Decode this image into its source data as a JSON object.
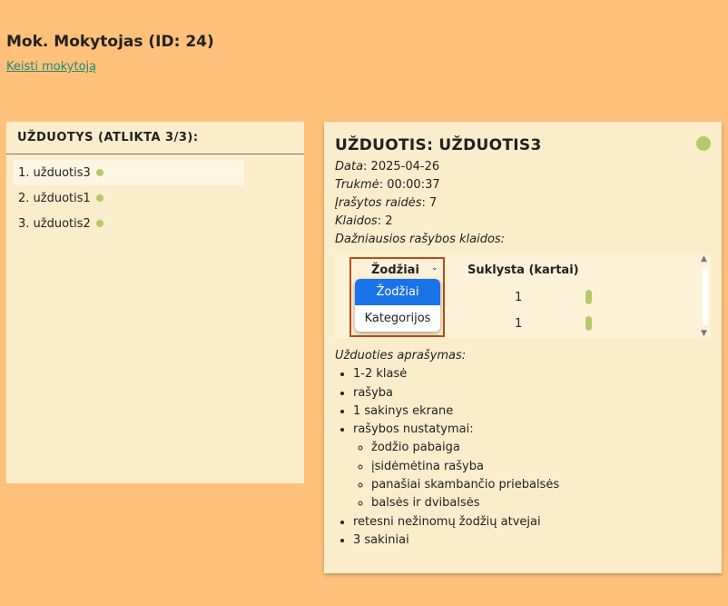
{
  "header": {
    "teacher": "Mok. Mokytojas (ID: 24)",
    "change_link": "Keisti mokytoją"
  },
  "task_list": {
    "title": "UŽDUOTYS (ATLIKTA 3/3):",
    "items": [
      {
        "label": "1. užduotis3"
      },
      {
        "label": "2. užduotis1"
      },
      {
        "label": "3. užduotis2"
      }
    ]
  },
  "task_detail": {
    "title": "UŽDUOTIS: UŽDUOTIS3",
    "date_label": "Data",
    "date_value": ": 2025-04-26",
    "duration_label": "Trukmė",
    "duration_value": ": 00:00:37",
    "letters_label": "Įrašytos raidės",
    "letters_value": ": 7",
    "errors_label": "Klaidos",
    "errors_value": ": 2",
    "frequent_label": "Dažniausios rašybos klaidos:",
    "table": {
      "col_words": "Žodžiai",
      "col_count": "Suklysta (kartai)",
      "rows": [
        {
          "count": "1"
        },
        {
          "count": "1"
        }
      ]
    },
    "dropdown": {
      "options": [
        "Žodžiai",
        "Kategorijos"
      ],
      "selected": "Žodžiai"
    },
    "description_label": "Užduoties aprašymas:",
    "description_items": [
      "1-2 klasė",
      "rašyba",
      "1 sakinys ekrane",
      "rašybos nustatymai:"
    ],
    "description_subitems": [
      "žodžio pabaiga",
      "įsidėmėtina rašyba",
      "panašiai skambančio priebalsės",
      "balsės ir dvibalsės"
    ],
    "description_items_after": [
      "retesni nežinomų žodžių atvejai",
      "3 sakiniai"
    ]
  },
  "colors": {
    "background": "#ffc17a",
    "panel": "#fbedcb",
    "status": "#b5c96a",
    "accent_frame": "#c04a15",
    "dropdown_active": "#1a73e8"
  }
}
